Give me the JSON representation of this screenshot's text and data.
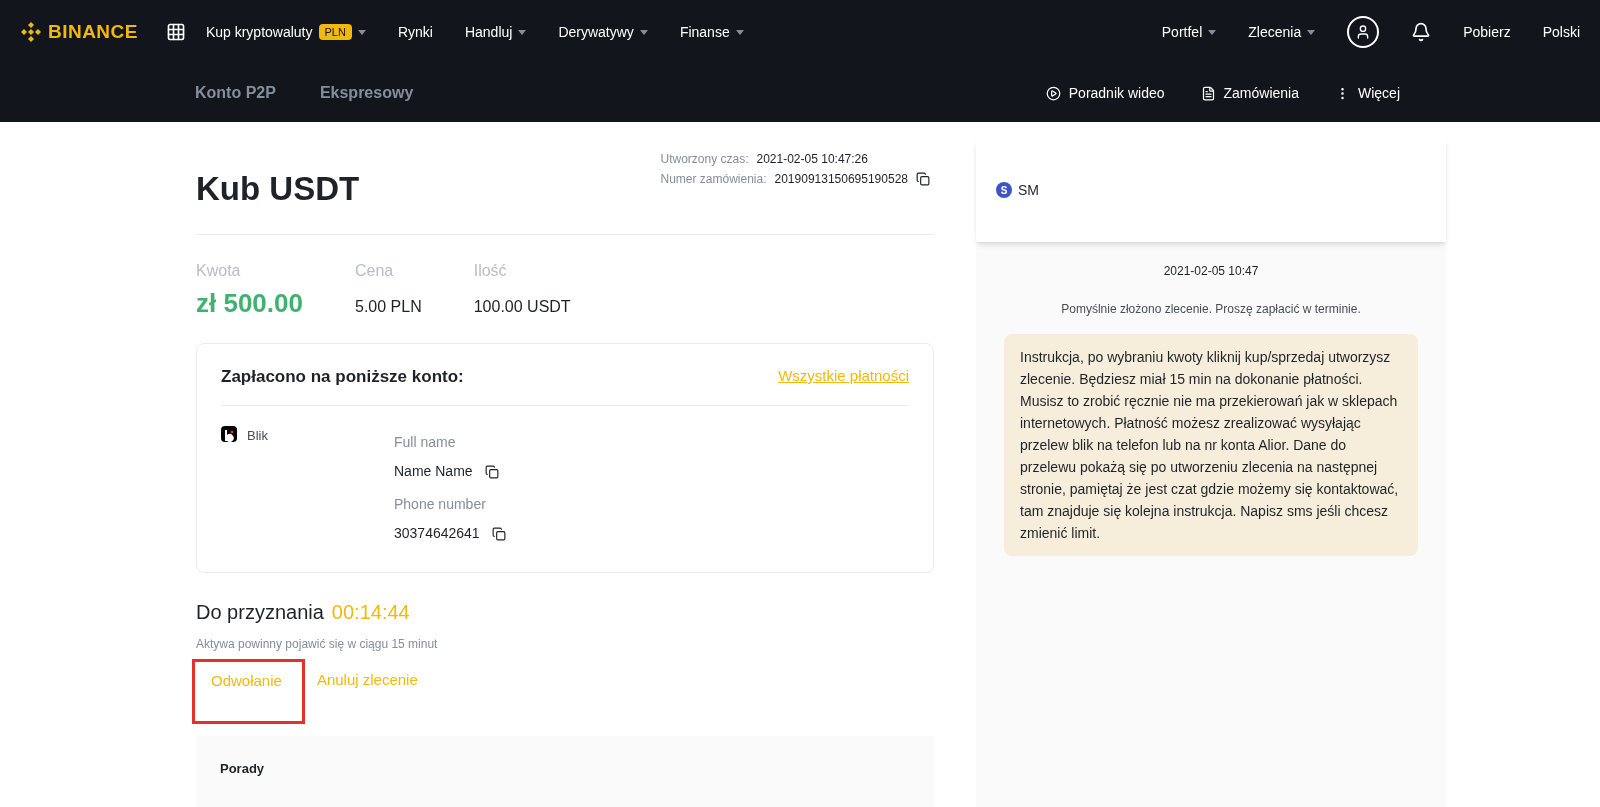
{
  "header": {
    "logo": "BINANCE",
    "nav": [
      {
        "label": "Kup kryptowaluty",
        "badge": "PLN",
        "dropdown": true
      },
      {
        "label": "Rynki",
        "dropdown": false
      },
      {
        "label": "Handluj",
        "dropdown": true
      },
      {
        "label": "Derywatywy",
        "dropdown": true
      },
      {
        "label": "Finanse",
        "dropdown": true
      }
    ],
    "right_nav": [
      {
        "label": "Portfel",
        "dropdown": true
      },
      {
        "label": "Zlecenia",
        "dropdown": true
      }
    ],
    "links": [
      "Pobierz",
      "Polski"
    ]
  },
  "subnav": {
    "tabs": [
      {
        "label": "Konto P2P",
        "selected": false
      },
      {
        "label": "Ekspresowy",
        "selected": false
      }
    ],
    "actions": [
      {
        "label": "Poradnik wideo",
        "kind": "video"
      },
      {
        "label": "Zamówienia",
        "kind": "document"
      },
      {
        "label": "Więcej",
        "kind": "more"
      }
    ]
  },
  "order": {
    "title": "Kub USDT",
    "meta": [
      {
        "label": "Utworzony czas:",
        "value": "2021-02-05 10:47:26",
        "copyable": false
      },
      {
        "label": "Numer zamówienia:",
        "value": "20190913150695190528",
        "copyable": true
      }
    ],
    "stats": [
      {
        "label": "Kwota",
        "value": "zł 500.00",
        "kind": "amount"
      },
      {
        "label": "Cena",
        "value": "5.00 PLN",
        "kind": "plain"
      },
      {
        "label": "Ilość",
        "value": "100.00 USDT",
        "kind": "plain"
      }
    ],
    "payment": {
      "heading": "Zapłacono na poniższe konto:",
      "link": "Wszystkie płatności",
      "method": "Blik",
      "fields": [
        {
          "label": "Full name",
          "value": "Name Name"
        },
        {
          "label": "Phone number",
          "value": "30374642641"
        }
      ]
    },
    "timer": {
      "label": "Do przyznania",
      "value": "00:14:44",
      "note": "Aktywa powinny pojawić się w ciągu 15 minut"
    },
    "buttons": [
      {
        "label": "Odwołanie",
        "highlighted": true
      },
      {
        "label": "Anuluj zlecenie",
        "highlighted": false
      }
    ],
    "tips": {
      "title": "Porady"
    }
  },
  "chat": {
    "user": {
      "initial": "S",
      "name": "SM"
    },
    "date": "2021-02-05 10:47",
    "system": "Pomyślnie złożono zlecenie. Proszę zapłacić w terminie.",
    "message": "Instrukcja, po wybraniu kwoty kliknij kup/sprzedaj utworzysz zlecenie. Będziesz miał 15 min na dokonanie płatności. Musisz to zrobić ręcznie nie ma przekierowań jak w sklepach internetowych. Płatność możesz zrealizować wysyłając przelew blik na telefon lub na nr konta Alior. Dane do przelewu pokażą się po utworzeniu zlecenia na następnej stronie, pamiętaj że jest czat gdzie możemy się kontaktować, tam znajduje się kolejna instrukcja. Napisz sms jeśli chcesz zmienić limit."
  }
}
